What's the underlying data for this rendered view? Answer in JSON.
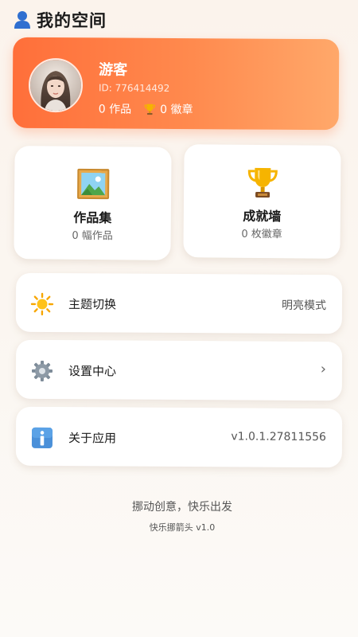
{
  "header": {
    "title": "我的空间",
    "icon": "user-icon"
  },
  "profile": {
    "name": "游客",
    "id_text": "ID: 776414492",
    "works_text": "0 作品",
    "badges_text": "0 徽章"
  },
  "tiles": [
    {
      "title": "作品集",
      "subtitle": "0 幅作品",
      "icon": "framed-picture-icon"
    },
    {
      "title": "成就墙",
      "subtitle": "0 枚徽章",
      "icon": "trophy-icon"
    }
  ],
  "settings": [
    {
      "label": "主题切换",
      "value": "明亮模式",
      "icon": "sun-icon"
    },
    {
      "label": "设置中心",
      "value": "›",
      "icon": "gear-icon"
    },
    {
      "label": "关于应用",
      "value": "v1.0.1.27811556",
      "icon": "info-icon"
    }
  ],
  "footer": {
    "slogan": "挪动创意，快乐出发",
    "version": "快乐挪箭头 v1.0"
  },
  "colors": {
    "accent_start": "#ff6f3a",
    "accent_end": "#ffa86a",
    "background": "#fbf5ef"
  }
}
